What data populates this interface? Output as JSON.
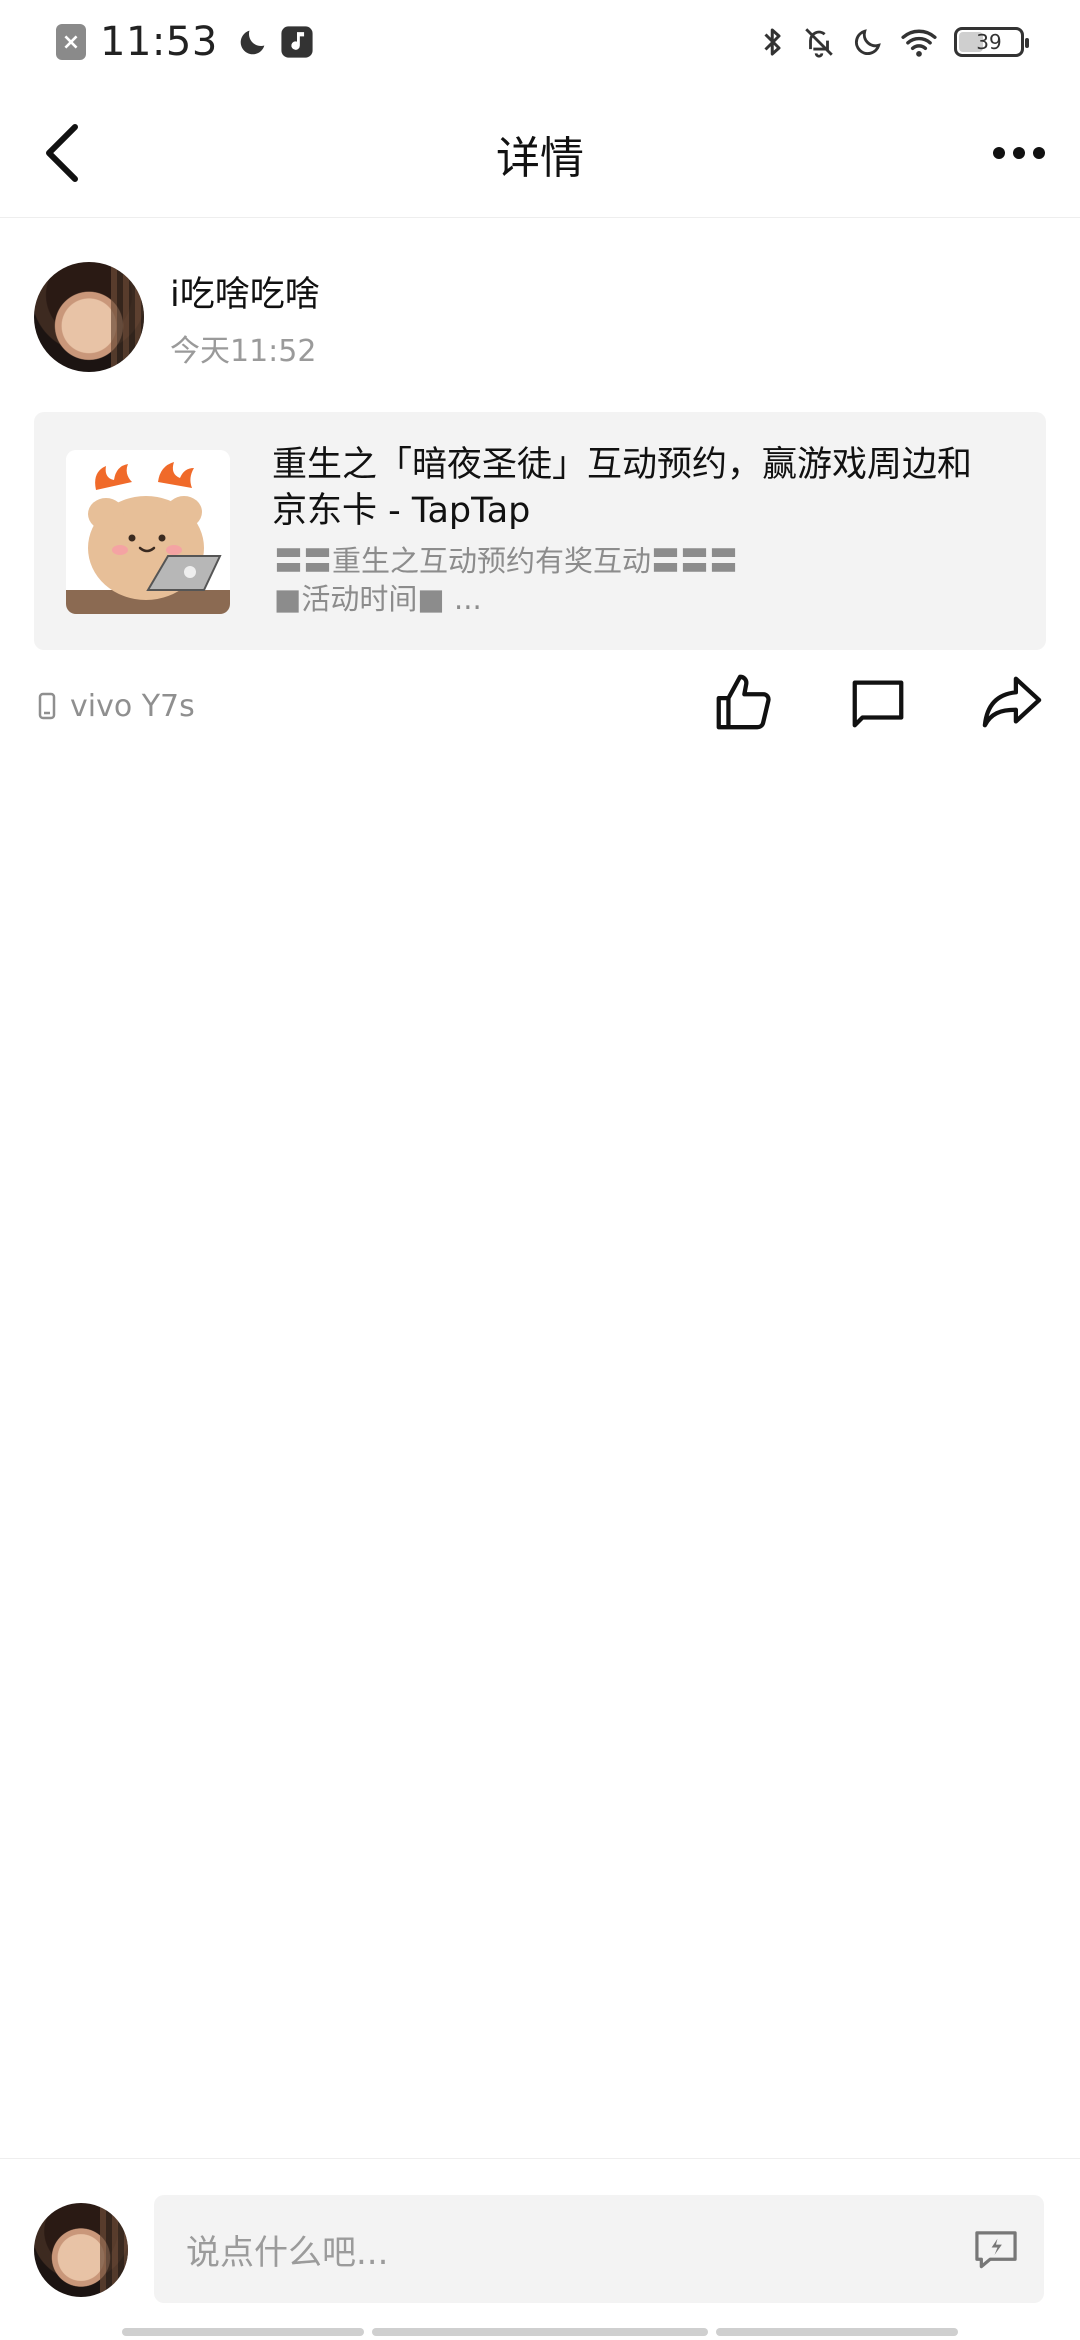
{
  "status_bar": {
    "time": "11:53",
    "battery_level": "39",
    "icons": [
      "close-box-icon",
      "moon-icon",
      "music-note-icon",
      "bluetooth-icon",
      "bell-off-icon",
      "moon-icon",
      "wifi-icon",
      "battery-icon"
    ]
  },
  "header": {
    "title": "详情",
    "back_icon": "chevron-left-icon",
    "more_icon": "more-dots-icon"
  },
  "post": {
    "username": "i吃啥吃啥",
    "time": "今天11:52",
    "card": {
      "title": "重生之「暗夜圣徒」互动预约，赢游戏周边和京东卡 - TapTap",
      "description_line1": "〓〓重生之互动预约有奖互动〓〓〓",
      "description_line2": "■活动时间■ ..."
    },
    "device": "vivo Y7s",
    "actions": [
      "like-icon",
      "comment-icon",
      "share-icon"
    ]
  },
  "composer": {
    "placeholder": "说点什么吧..."
  },
  "colors": {
    "text_primary": "#111111",
    "text_secondary": "#9a9a9a",
    "card_background": "#f3f3f3",
    "divider": "#eeeeee"
  }
}
